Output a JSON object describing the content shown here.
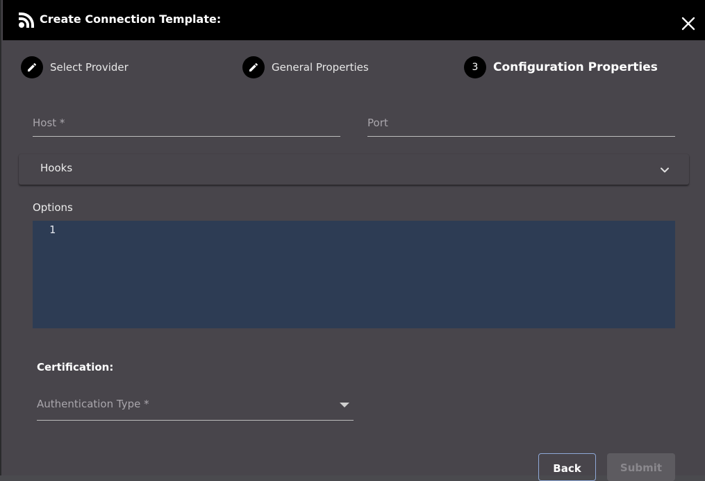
{
  "dialog": {
    "title": "Create Connection Template:",
    "title_icon": "rss-feed-icon",
    "close_icon": "close-icon"
  },
  "stepper": {
    "steps": [
      {
        "label": "Select Provider",
        "marker": "edit-icon",
        "state": "completed"
      },
      {
        "label": "General Properties",
        "marker": "edit-icon",
        "state": "completed"
      },
      {
        "label": "Configuration Properties",
        "marker": "3",
        "state": "active"
      }
    ]
  },
  "form": {
    "host": {
      "label": "Host *",
      "value": ""
    },
    "port": {
      "label": "Port",
      "value": ""
    },
    "hooks": {
      "label": "Hooks",
      "expanded": false
    },
    "options": {
      "label": "Options",
      "line_numbers": [
        "1"
      ],
      "content": ""
    },
    "certification": {
      "heading": "Certification:",
      "auth_type": {
        "label": "Authentication Type *",
        "value": ""
      }
    }
  },
  "actions": {
    "back_label": "Back",
    "submit_label": "Submit",
    "submit_disabled": true
  },
  "colors": {
    "titlebar": "#000000",
    "dialog_bg": "#48454b",
    "editor_bg": "#2d3c54",
    "back_border": "#8fa9d8"
  }
}
